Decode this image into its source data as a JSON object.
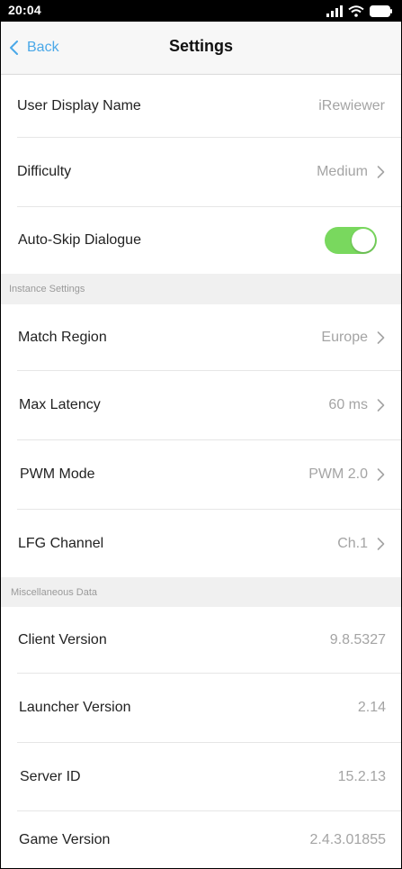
{
  "status_bar": {
    "time": "20:04"
  },
  "nav": {
    "back_label": "Back",
    "title": "Settings"
  },
  "general": {
    "user_display_name": {
      "label": "User Display Name",
      "value": "iRewiewer"
    },
    "difficulty": {
      "label": "Difficulty",
      "value": "Medium"
    },
    "auto_skip": {
      "label": "Auto-Skip Dialogue",
      "on": true
    }
  },
  "instance_settings": {
    "header": "Instance Settings",
    "match_region": {
      "label": "Match Region",
      "value": "Europe"
    },
    "max_latency": {
      "label": "Max Latency",
      "value": "60 ms"
    },
    "pwm_mode": {
      "label": "PWM Mode",
      "value": "PWM 2.0"
    },
    "lfg_channel": {
      "label": "LFG Channel",
      "value": "Ch.1"
    }
  },
  "misc": {
    "header": "Miscellaneous Data",
    "client_version": {
      "label": "Client Version",
      "value": "9.8.5327"
    },
    "launcher_version": {
      "label": "Launcher Version",
      "value": "2.14"
    },
    "server_id": {
      "label": "Server ID",
      "value": "15.2.13"
    },
    "game_version": {
      "label": "Game Version",
      "value": "2.4.3.01855"
    }
  },
  "colors": {
    "accent": "#4aa8e8",
    "toggle_on": "#79d85e",
    "value_text": "#a4a4a4",
    "section_bg": "#f0f0f0"
  },
  "icons": {
    "back": "chevron-left-icon",
    "row_disclosure": "chevron-right-icon",
    "signal": "cellular-signal-icon",
    "wifi": "wifi-icon",
    "battery": "battery-icon"
  }
}
